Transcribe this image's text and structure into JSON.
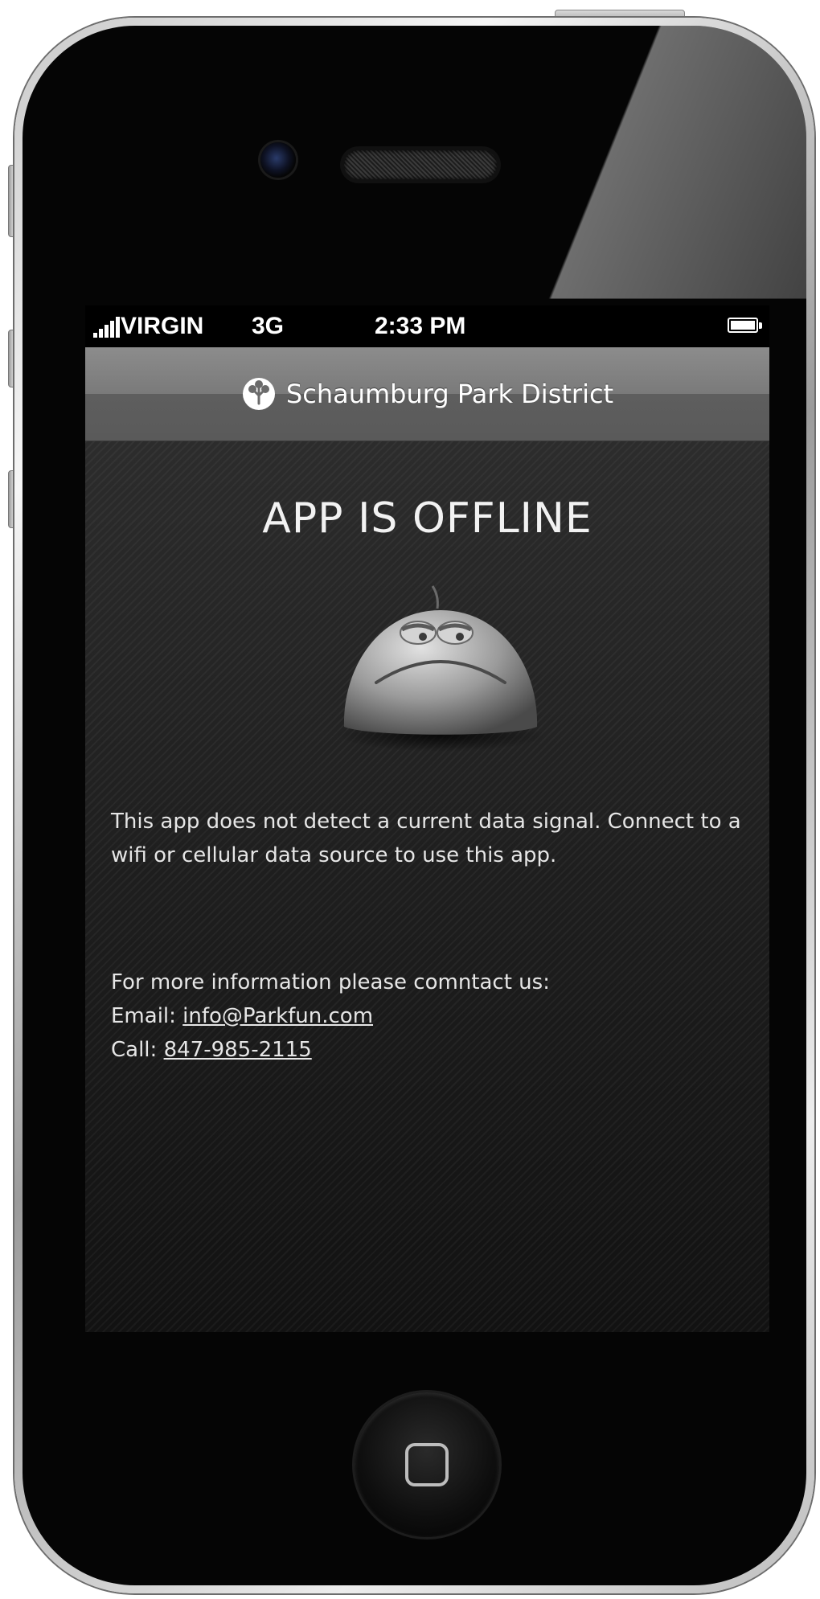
{
  "status_bar": {
    "carrier": "VIRGIN",
    "network": "3G",
    "time": "2:33 PM"
  },
  "nav": {
    "title": "Schaumburg Park District",
    "logo_icon": "tree-icon"
  },
  "offline": {
    "title": "APP IS OFFLINE",
    "illustration_icon": "sad-face-icon",
    "message": "This app does not detect a current data signal. Connect to a wifi or cellular data source to use this app."
  },
  "contact": {
    "intro": "For more information please comntact us:",
    "email_label": "Email:",
    "email": "info@Parkfun.com",
    "call_label": "Call:",
    "phone": "847-985-2115"
  },
  "device": {
    "home_button_icon": "home-button-icon"
  }
}
